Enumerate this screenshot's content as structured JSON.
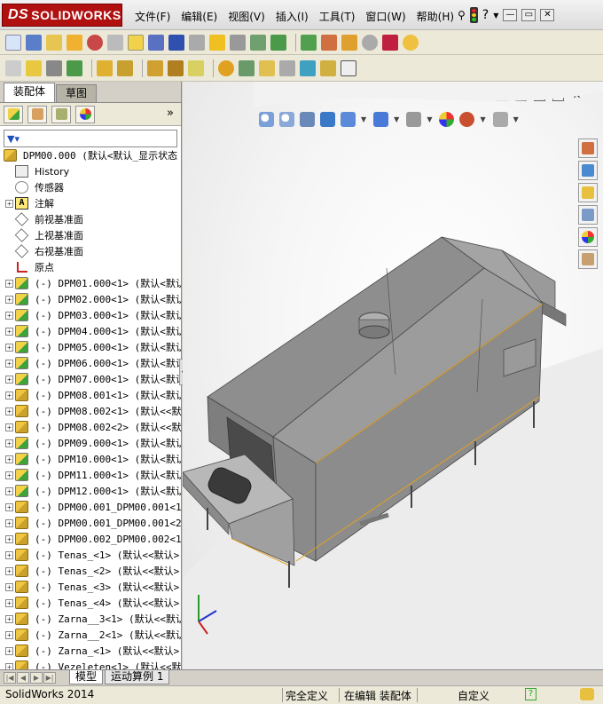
{
  "app": {
    "logo_text": "SOLIDWORKS",
    "logo_mark": "DS"
  },
  "menu": [
    "文件(F)",
    "编辑(E)",
    "视图(V)",
    "插入(I)",
    "工具(T)",
    "窗口(W)",
    "帮助(H)"
  ],
  "top_right": {
    "help": "?",
    "minimize": "—",
    "restore": "▭",
    "close": "✕"
  },
  "panel": {
    "tabs": [
      "装配体",
      "草图"
    ],
    "active_tab": "装配体",
    "expand_arrow": "»",
    "filter_glyph": "▼▾"
  },
  "tree": {
    "root": "DPM00.000  (默认<默认_显示状态",
    "items": [
      {
        "label": "History",
        "icon": "history-icon",
        "expand": ""
      },
      {
        "label": "传感器",
        "icon": "sensor-icon",
        "expand": ""
      },
      {
        "label": "注解",
        "icon": "annotation-icon",
        "expand": "+"
      },
      {
        "label": "前视基准面",
        "icon": "plane-icon",
        "expand": ""
      },
      {
        "label": "上视基准面",
        "icon": "plane-icon",
        "expand": ""
      },
      {
        "label": "右视基准面",
        "icon": "plane-icon",
        "expand": ""
      },
      {
        "label": "原点",
        "icon": "origin-icon",
        "expand": ""
      },
      {
        "label": "(-) DPM01.000<1>  (默认<默认/",
        "icon": "part-icon",
        "expand": "+"
      },
      {
        "label": "(-) DPM02.000<1>  (默认<默认/",
        "icon": "part-icon",
        "expand": "+"
      },
      {
        "label": "(-) DPM03.000<1>  (默认<默认/",
        "icon": "part-icon",
        "expand": "+"
      },
      {
        "label": "(-) DPM04.000<1>  (默认<默认/",
        "icon": "part-icon",
        "expand": "+"
      },
      {
        "label": "(-) DPM05.000<1>  (默认<默认/",
        "icon": "part-icon",
        "expand": "+"
      },
      {
        "label": "(-) DPM06.000<1>  (默认<默认/",
        "icon": "part-icon",
        "expand": "+"
      },
      {
        "label": "(-) DPM07.000<1>  (默认<默认/",
        "icon": "part-icon",
        "expand": "+"
      },
      {
        "label": "(-) DPM08.001<1>  (默认<默认",
        "icon": "assembly-icon",
        "expand": "+"
      },
      {
        "label": "(-) DPM08.002<1>  (默认<<默认",
        "icon": "assembly-icon",
        "expand": "+"
      },
      {
        "label": "(-) DPM08.002<2>  (默认<<默认",
        "icon": "assembly-icon",
        "expand": "+"
      },
      {
        "label": "(-) DPM09.000<1>  (默认<默认/",
        "icon": "part-icon",
        "expand": "+"
      },
      {
        "label": "(-) DPM10.000<1>  (默认<默认/",
        "icon": "part-icon",
        "expand": "+"
      },
      {
        "label": "(-) DPM11.000<1>  (默认<默认/",
        "icon": "part-icon",
        "expand": "+"
      },
      {
        "label": "(-) DPM12.000<1>  (默认<默认/",
        "icon": "part-icon",
        "expand": "+"
      },
      {
        "label": "(-) DPM00.001_DPM00.001<1>",
        "icon": "assembly-icon",
        "expand": "+"
      },
      {
        "label": "(-) DPM00.001_DPM00.001<2>",
        "icon": "assembly-icon",
        "expand": "+"
      },
      {
        "label": "(-) DPM00.002_DPM00.002<1>",
        "icon": "assembly-icon",
        "expand": "+"
      },
      {
        "label": "(-) Tenas_<1>  (默认<<默认>",
        "icon": "assembly-icon",
        "expand": "+"
      },
      {
        "label": "(-) Tenas_<2>  (默认<<默认>",
        "icon": "assembly-icon",
        "expand": "+"
      },
      {
        "label": "(-) Tenas_<3>  (默认<<默认>",
        "icon": "assembly-icon",
        "expand": "+"
      },
      {
        "label": "(-) Tenas_<4>  (默认<<默认>",
        "icon": "assembly-icon",
        "expand": "+"
      },
      {
        "label": "(-) Zarna__3<1>  (默认<<默认",
        "icon": "assembly-icon",
        "expand": "+"
      },
      {
        "label": "(-) Zarna__2<1>  (默认<<默认",
        "icon": "assembly-icon",
        "expand": "+"
      },
      {
        "label": "(-) Zarna_<1>  (默认<<默认>",
        "icon": "assembly-icon",
        "expand": "+"
      },
      {
        "label": "(-) Vezeleten<1>  (默认<<默认",
        "icon": "assembly-icon",
        "expand": "+"
      }
    ]
  },
  "bottom_tabs": {
    "model": "模型",
    "motion": "运动算例 1"
  },
  "status": {
    "app_version": "SolidWorks 2014",
    "definition": "完全定义",
    "edit_state": "在编辑 装配体",
    "units": "自定义",
    "help_glyph": "?"
  },
  "colors": {
    "logo_red": "#b01010",
    "toolbar_bg": "#ece9d8",
    "model_gray": "#8c8c8c",
    "edge_orange": "#e0a020"
  }
}
